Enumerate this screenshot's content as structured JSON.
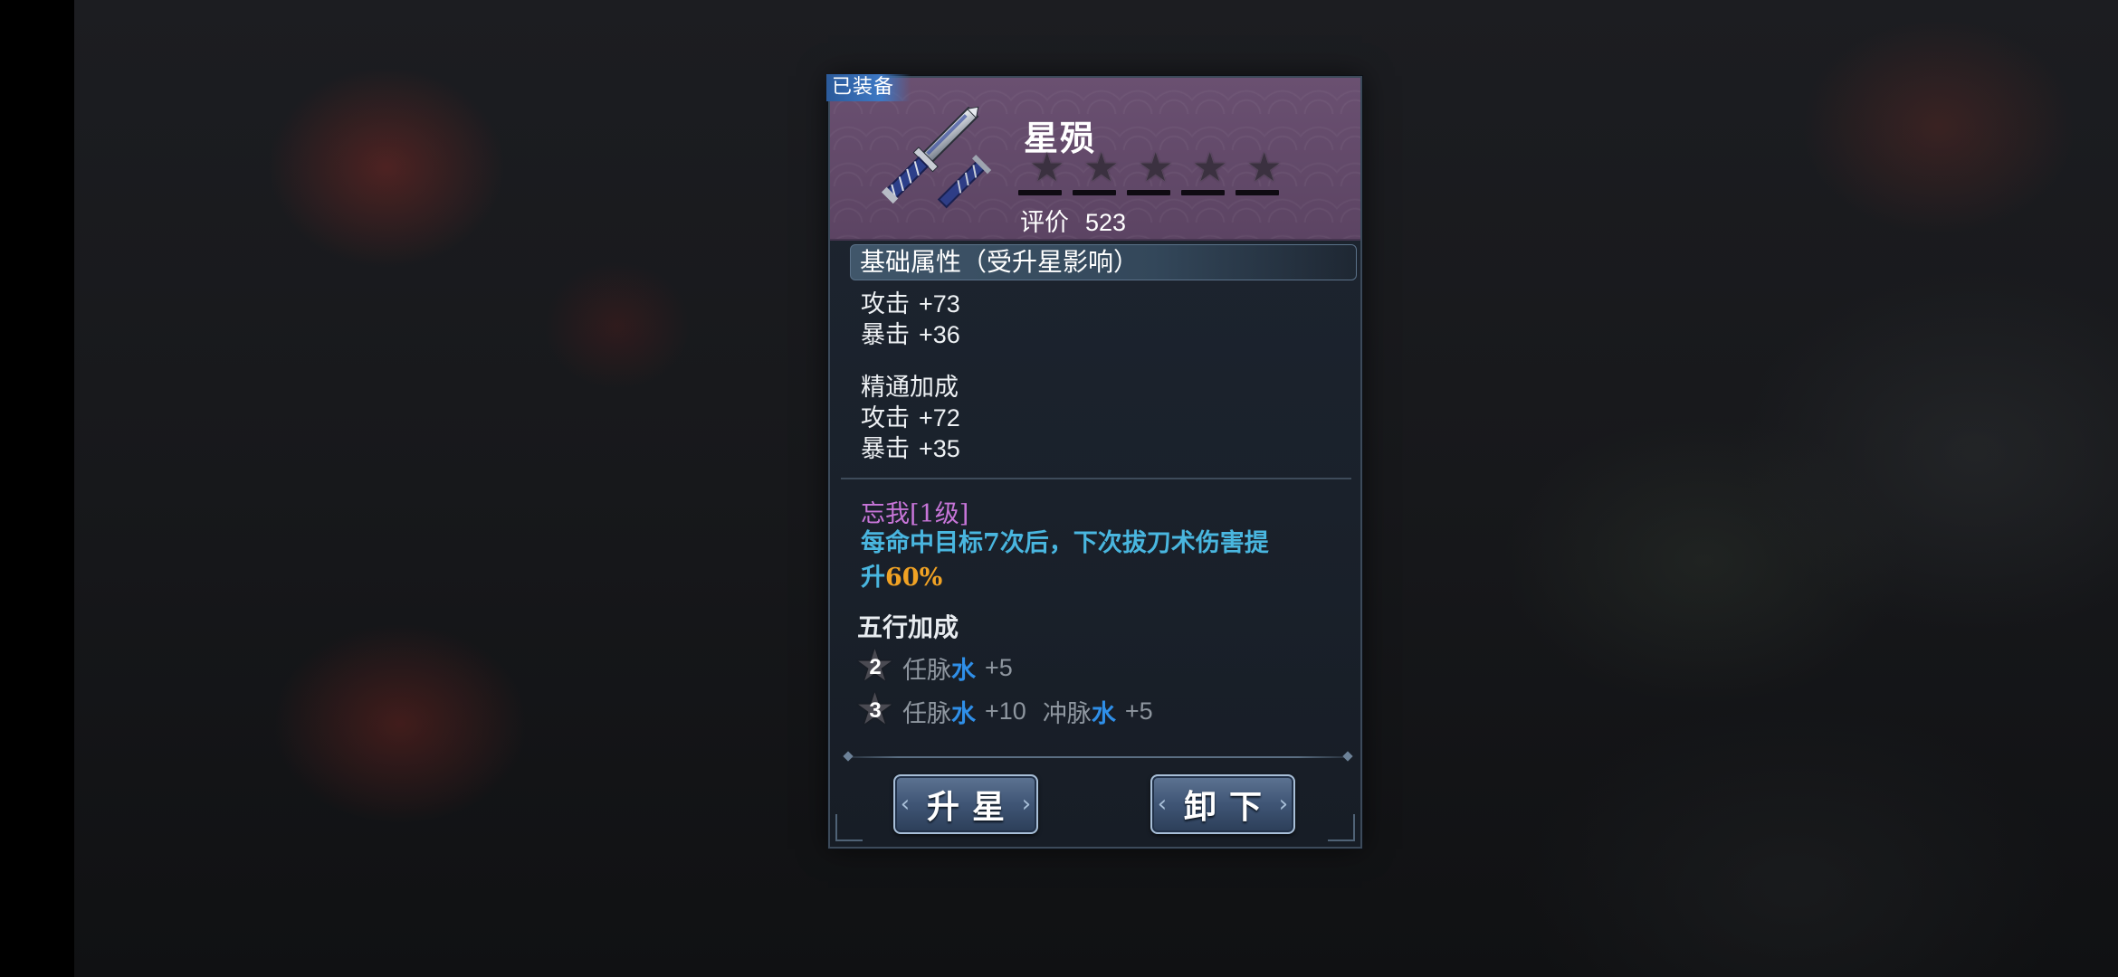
{
  "equipped_tag": "已装备",
  "item": {
    "name": "星殒",
    "stars_total": 5,
    "stars_filled": 0,
    "rating_label": "评价",
    "rating_value": "523"
  },
  "base_attributes": {
    "header": "基础属性（受升星影响）",
    "stats": [
      {
        "label": "攻击",
        "value": "+73"
      },
      {
        "label": "暴击",
        "value": "+36"
      }
    ]
  },
  "mastery_bonus": {
    "title": "精通加成",
    "stats": [
      {
        "label": "攻击",
        "value": "+72"
      },
      {
        "label": "暴击",
        "value": "+35"
      }
    ]
  },
  "skill": {
    "title": "忘我[1级]",
    "desc_line1": "每命中目标7次后，下次拔刀术伤害提",
    "desc_line2_prefix": "升",
    "desc_percent": "60%"
  },
  "wuxing": {
    "title": "五行加成",
    "rows": [
      {
        "badge": "2",
        "entries": [
          {
            "meridian": "任脉",
            "element": "水",
            "value": "+5"
          }
        ]
      },
      {
        "badge": "3",
        "entries": [
          {
            "meridian": "任脉",
            "element": "水",
            "value": "+10"
          },
          {
            "meridian": "冲脉",
            "element": "水",
            "value": "+5"
          }
        ]
      }
    ]
  },
  "buttons": {
    "upgrade": "升星",
    "unequip": "卸下"
  },
  "colors": {
    "header_purple": "#5f4766",
    "skill_title": "#c775d8",
    "skill_desc": "#49b6df",
    "percent_highlight": "#f0a224",
    "water_element": "#2f8fe8"
  }
}
